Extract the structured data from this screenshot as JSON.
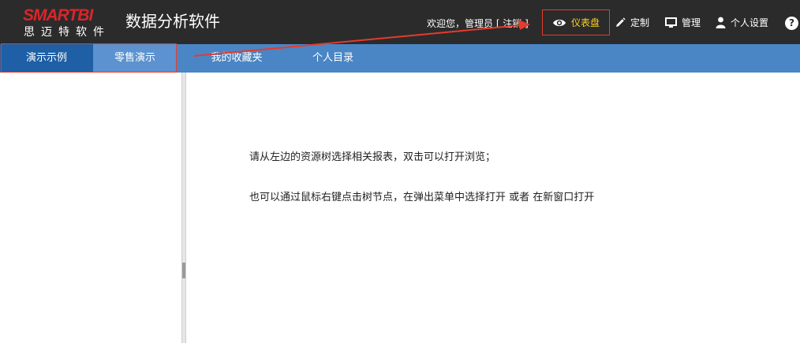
{
  "logo": {
    "top": "SMART",
    "top_b": "BI",
    "bottom": "思迈特软件"
  },
  "app": {
    "title": "数据分析软件"
  },
  "header": {
    "welcome": "欢迎您，管理员 [ 注销 ]",
    "nav": {
      "dashboard": "仪表盘",
      "custom": "定制",
      "manage": "管理",
      "settings": "个人设置"
    },
    "help": "?"
  },
  "tabs": [
    {
      "label": "演示示例"
    },
    {
      "label": "零售演示"
    },
    {
      "label": "我的收藏夹"
    },
    {
      "label": "个人目录"
    }
  ],
  "main": {
    "line1": "请从左边的资源树选择相关报表，双击可以打开浏览；",
    "line2": "也可以通过鼠标右键点击树节点，在弹出菜单中选择打开 或者 在新窗口打开"
  },
  "colors": {
    "header_bg": "#2b2b2b",
    "tabbar_bg": "#4a86c5",
    "annotation_red": "#e53b2c",
    "dashboard_yellow": "#ffd21c"
  },
  "icons": [
    "eye-icon",
    "pencil-icon",
    "monitor-icon",
    "person-icon",
    "help-icon"
  ]
}
